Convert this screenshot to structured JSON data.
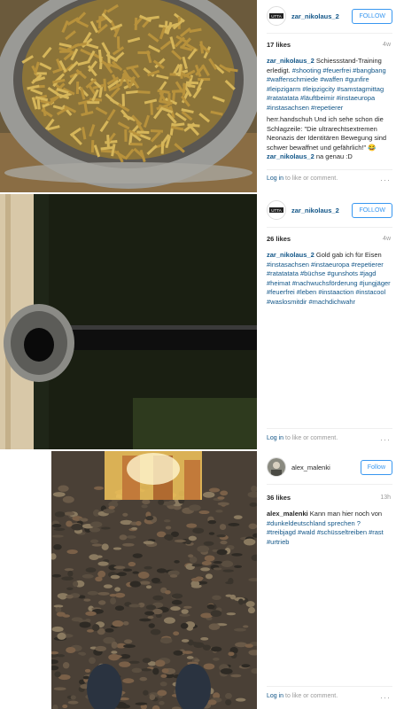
{
  "posts": [
    {
      "username": "zar_nikolaus_2",
      "avatar_text": "UTTA",
      "follow_label": "FOLLOW",
      "likes": "17 likes",
      "age": "4w",
      "caption_user": "zar_nikolaus_2",
      "caption_text": "Schiessstand-Training erledigt.",
      "caption_tags": "#shooting #feuerfrei #bangbang #waffenschmiede #waffen #gunfire #leipzigarm #leipzigcity #samstagmittag #ratatatata #läuftbeimir #instaeuropa #instasachsen #repetierer",
      "comments": [
        {
          "user": "herr.handschuh",
          "text": "Und ich sehe schon die Schlagzeile: \"Die ultrarechtsextremen Neonazis der Identitären Bewegung sind schwer bewaffnet und gefährlich!\" 😂"
        },
        {
          "user": "zar_nikolaus_2",
          "text": "na genau :D"
        }
      ],
      "footer_login": "Log in",
      "footer_text": "to like or comment.",
      "footer_more": "···"
    },
    {
      "username": "zar_nikolaus_2",
      "avatar_text": "UTTA",
      "follow_label": "FOLLOW",
      "likes": "26 likes",
      "age": "4w",
      "caption_user": "zar_nikolaus_2",
      "caption_text": "Gold gab ich für Eisen",
      "caption_tags": "#instasachsen #instaeuropa #repetierer #ratatatata #büchse #gunshots #jagd #heimat #nachwuchsförderung #jungjäger #feuerfrei #leben #instaaction #instacool #waslosmitdir #machdichwahr",
      "comments": [],
      "footer_login": "Log in",
      "footer_text": "to like or comment.",
      "footer_more": "···"
    },
    {
      "username": "alex_malenki",
      "avatar_text": "",
      "follow_label": "Follow",
      "likes": "36 likes",
      "age": "13h",
      "caption_user": "alex_malenki",
      "caption_text": "Kann man hier noch von",
      "caption_tags": "#dunkeldeutschland sprechen ? #treibjagd #wald #schüsseltreiben #rast #urtrieb",
      "comments": [],
      "footer_login": "Log in",
      "footer_text": "to like or comment.",
      "footer_more": "···"
    }
  ],
  "colors": {
    "link": "#125688",
    "follow": "#3897f0",
    "muted": "#999999"
  }
}
